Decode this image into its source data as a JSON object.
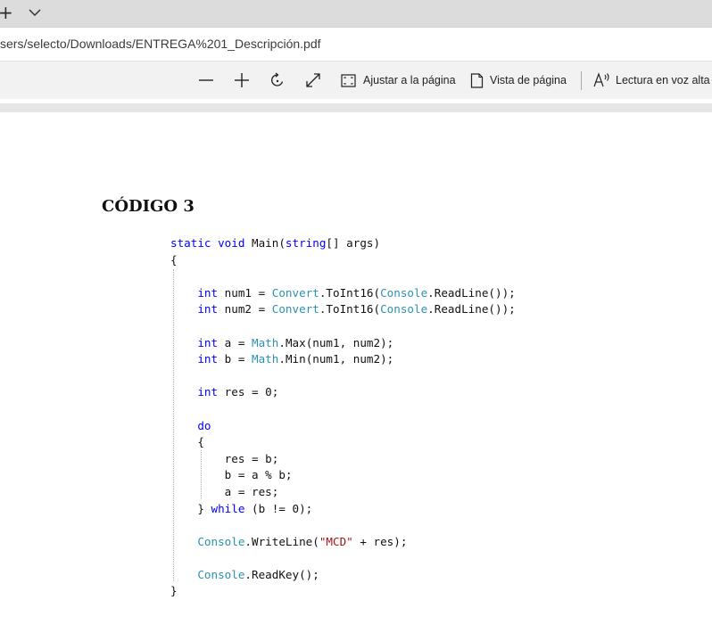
{
  "tabstrip": {
    "new_tab_icon": "plus-icon",
    "tab_list_icon": "chevron-down-icon"
  },
  "address_bar": {
    "url": "sers/selecto/Downloads/ENTREGA%201_Descripción.pdf"
  },
  "pdf_toolbar": {
    "zoom_out_icon": "minus-icon",
    "zoom_in_icon": "plus-icon",
    "rotate_icon": "rotate-icon",
    "fullscreen_icon": "expand-icon",
    "fit_page_label": "Ajustar a la página",
    "page_view_label": "Vista de página",
    "read_aloud_label": "Lectura en voz alta"
  },
  "document": {
    "heading": "CÓDIGO 3",
    "code_lines": [
      [
        {
          "t": "static void",
          "c": "kw"
        },
        {
          "t": " Main("
        },
        {
          "t": "string",
          "c": "kw"
        },
        {
          "t": "[] args)"
        }
      ],
      [
        {
          "t": "{"
        }
      ],
      [],
      [
        {
          "t": "    "
        },
        {
          "t": "int",
          "c": "kw"
        },
        {
          "t": " num1 = "
        },
        {
          "t": "Convert",
          "c": "ty"
        },
        {
          "t": ".ToInt16("
        },
        {
          "t": "Console",
          "c": "ty"
        },
        {
          "t": ".ReadLine());"
        }
      ],
      [
        {
          "t": "    "
        },
        {
          "t": "int",
          "c": "kw"
        },
        {
          "t": " num2 = "
        },
        {
          "t": "Convert",
          "c": "ty"
        },
        {
          "t": ".ToInt16("
        },
        {
          "t": "Console",
          "c": "ty"
        },
        {
          "t": ".ReadLine());"
        }
      ],
      [],
      [
        {
          "t": "    "
        },
        {
          "t": "int",
          "c": "kw"
        },
        {
          "t": " a = "
        },
        {
          "t": "Math",
          "c": "ty"
        },
        {
          "t": ".Max(num1, num2);"
        }
      ],
      [
        {
          "t": "    "
        },
        {
          "t": "int",
          "c": "kw"
        },
        {
          "t": " b = "
        },
        {
          "t": "Math",
          "c": "ty"
        },
        {
          "t": ".Min(num1, num2);"
        }
      ],
      [],
      [
        {
          "t": "    "
        },
        {
          "t": "int",
          "c": "kw"
        },
        {
          "t": " res = 0;"
        }
      ],
      [],
      [
        {
          "t": "    "
        },
        {
          "t": "do",
          "c": "kw"
        }
      ],
      [
        {
          "t": "    {"
        }
      ],
      [
        {
          "t": "        res = b;"
        }
      ],
      [
        {
          "t": "        b = a % b;"
        }
      ],
      [
        {
          "t": "        a = res;"
        }
      ],
      [
        {
          "t": "    } "
        },
        {
          "t": "while",
          "c": "kw"
        },
        {
          "t": " (b != 0);"
        }
      ],
      [],
      [
        {
          "t": "    "
        },
        {
          "t": "Console",
          "c": "ty"
        },
        {
          "t": ".WriteLine("
        },
        {
          "t": "\"MCD\"",
          "c": "str"
        },
        {
          "t": " + res);"
        }
      ],
      [],
      [
        {
          "t": "    "
        },
        {
          "t": "Console",
          "c": "ty"
        },
        {
          "t": ".ReadKey();"
        }
      ],
      [
        {
          "t": "}"
        }
      ]
    ]
  }
}
